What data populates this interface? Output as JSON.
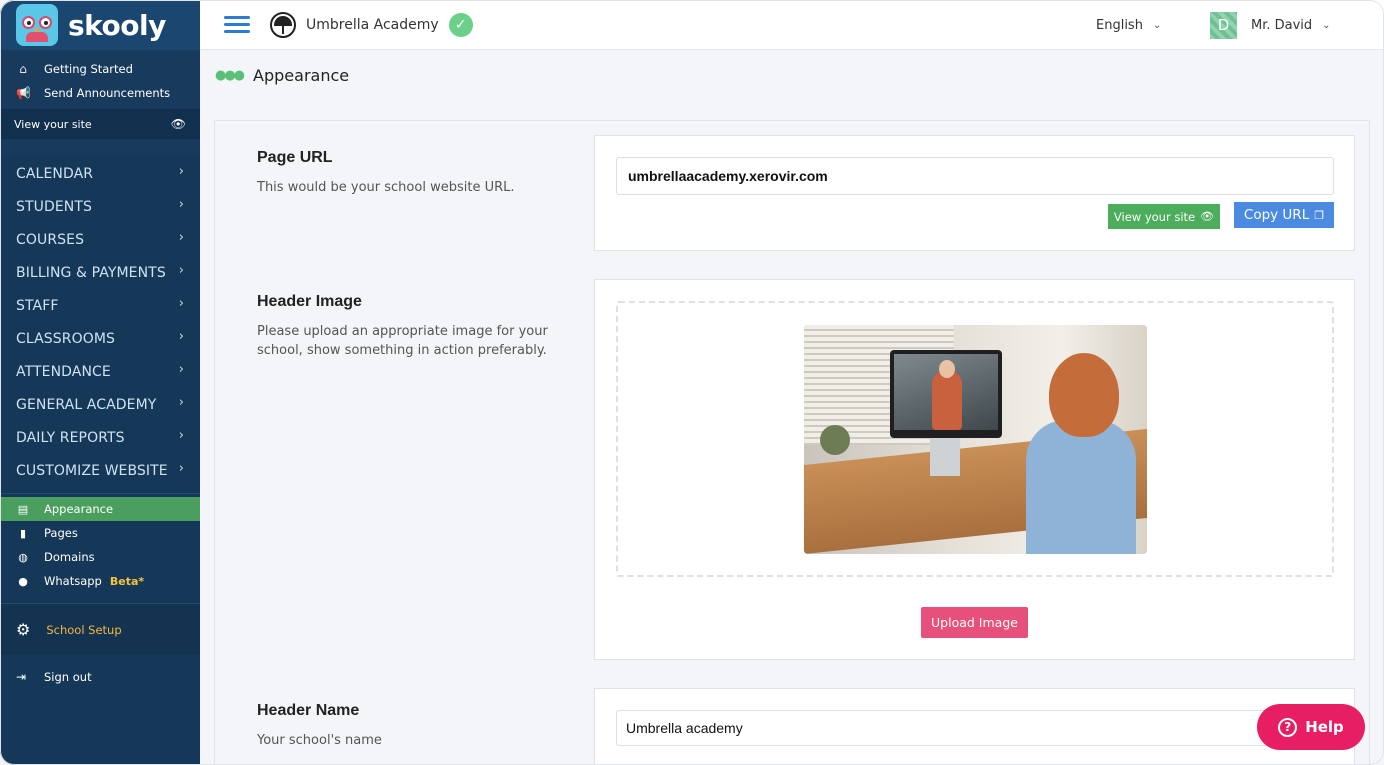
{
  "brand": {
    "name": "skooly"
  },
  "sidebar": {
    "top_links": [
      {
        "label": "Getting Started",
        "icon": "home-icon"
      },
      {
        "label": "Send Announcements",
        "icon": "megaphone-icon"
      }
    ],
    "view_site": "View your site",
    "nav": [
      "CALENDAR",
      "STUDENTS",
      "COURSES",
      "BILLING & PAYMENTS",
      "STAFF",
      "CLASSROOMS",
      "ATTENDANCE",
      "GENERAL ACADEMY",
      "DAILY REPORTS",
      "CUSTOMIZE WEBSITE"
    ],
    "sub_items": [
      {
        "label": "Appearance",
        "icon": "layout-icon",
        "active": true
      },
      {
        "label": "Pages",
        "icon": "file-icon"
      },
      {
        "label": "Domains",
        "icon": "globe-icon"
      },
      {
        "label": "Whatsapp",
        "icon": "whatsapp-icon",
        "badge": "Beta*"
      }
    ],
    "school_setup": "School Setup",
    "sign_out": "Sign out"
  },
  "topbar": {
    "school_name": "Umbrella Academy",
    "language": "English",
    "avatar_letter": "D",
    "user_name": "Mr. David"
  },
  "page": {
    "title": "Appearance"
  },
  "sections": {
    "page_url": {
      "title": "Page URL",
      "description": "This would be your school website URL.",
      "value": "umbrellaacademy.xerovir.com",
      "view_button": "View your site",
      "copy_button": "Copy URL"
    },
    "header_image": {
      "title": "Header Image",
      "description": "Please upload an appropriate image for your school, show something in action preferably.",
      "upload_button": "Upload Image"
    },
    "header_name": {
      "title": "Header Name",
      "description": "Your school's name",
      "value": "Umbrella academy"
    }
  },
  "help": {
    "label": "Help"
  },
  "colors": {
    "sidebar_bg": "#163858",
    "active_green": "#4a9f5e",
    "view_button": "#4cae5c",
    "copy_button": "#4a8ae0",
    "upload_button": "#e7507a",
    "help_button": "#e71e63",
    "setup_text": "#f5b83d"
  }
}
